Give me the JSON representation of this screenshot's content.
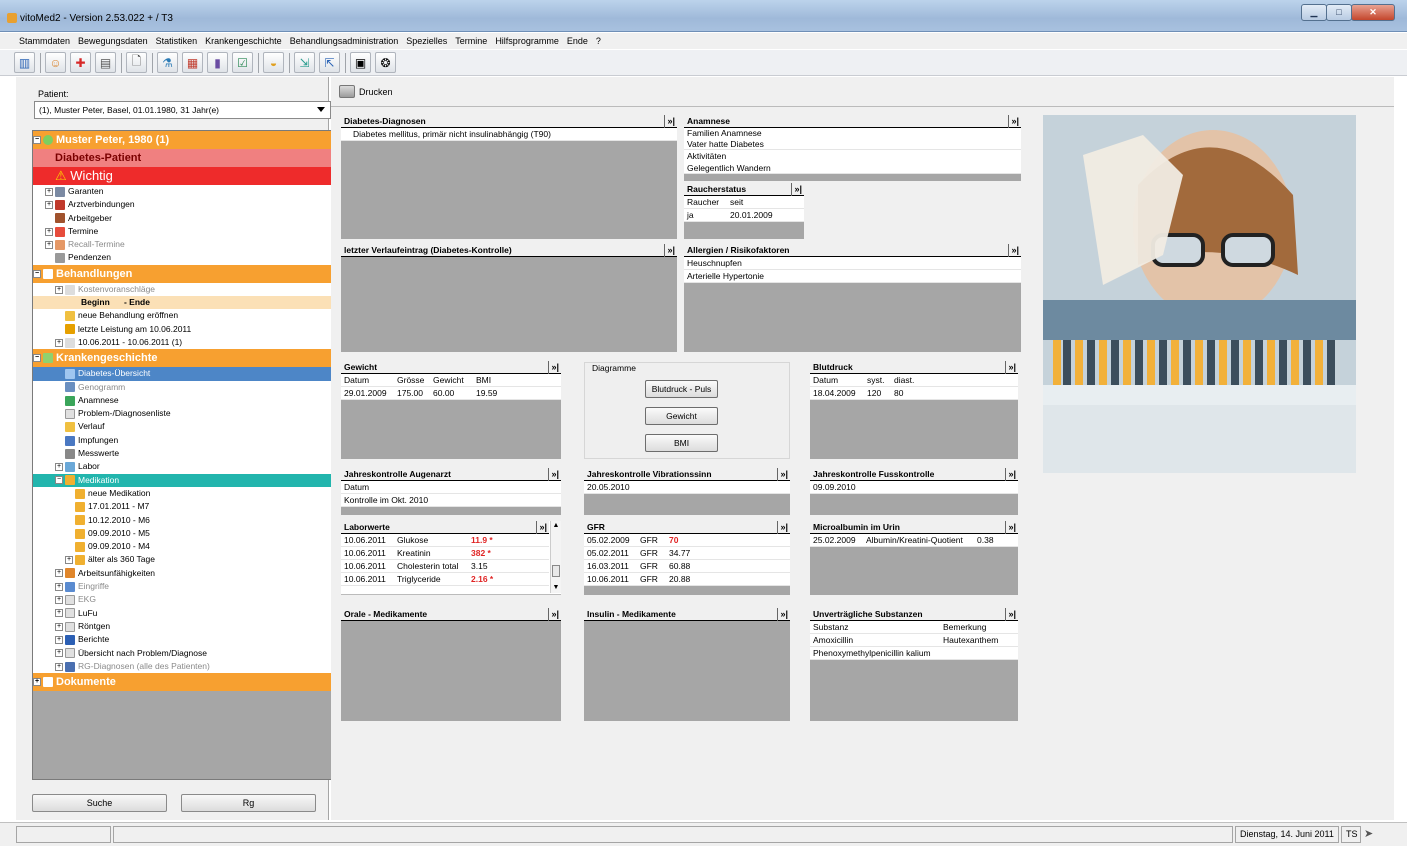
{
  "window": {
    "title": "vitoMed2 - Version 2.53.022 + / T3"
  },
  "menu": [
    "Stammdaten",
    "Bewegungsdaten",
    "Statistiken",
    "Krankengeschichte",
    "Behandlungsadministration",
    "Spezielles",
    "Termine",
    "Hilfsprogramme",
    "Ende",
    "?"
  ],
  "patient": {
    "label": "Patient:",
    "value": "(1), Muster Peter, Basel, 01.01.1980, 31 Jahr(e)"
  },
  "tree": {
    "patient_header": "Muster Peter, 1980 (1)",
    "diabetes": "Diabetes-Patient",
    "wichtig": "Wichtig",
    "items1": [
      "Garanten",
      "Arztverbindungen",
      "Arbeitgeber",
      "Termine",
      "Recall-Termine",
      "Pendenzen"
    ],
    "behandlungen": "Behandlungen",
    "kostenvoranschlaege": "Kostenvoranschläge",
    "beginn": "Beginn",
    "ende": "- Ende",
    "neue_behandlung": "neue Behandlung eröffnen",
    "letzte_leistung": "letzte Leistung am 10.06.2011",
    "period": "10.06.2011 - 10.06.2011  (1)",
    "krankengeschichte": "Krankengeschichte",
    "kg_items": [
      "Diabetes-Übersicht",
      "Genogramm",
      "Anamnese",
      "Problem-/Diagnosenliste",
      "Verlauf",
      "Impfungen",
      "Messwerte",
      "Labor"
    ],
    "medikation": "Medikation",
    "med_items": [
      "neue Medikation",
      "17.01.2011 - M7",
      "10.12.2010 - M6",
      "09.09.2010 - M5",
      "09.09.2010 - M4",
      "älter als 360 Tage"
    ],
    "items2": [
      "Arbeitsunfähigkeiten",
      "Eingriffe",
      "EKG",
      "LuFu",
      "Röntgen",
      "Berichte",
      "Übersicht nach Problem/Diagnose",
      "RG-Diagnosen (alle des Patienten)"
    ],
    "dokumente": "Dokumente"
  },
  "buttons": {
    "suche": "Suche",
    "rg": "Rg",
    "drucken": "Drucken"
  },
  "widgets": {
    "more": "»|",
    "diabetes_diagnosen": {
      "title": "Diabetes-Diagnosen",
      "line": "Diabetes mellitus, primär nicht insulinabhängig (T90)"
    },
    "anamnese": {
      "title": "Anamnese",
      "lines": [
        "Familien Anamnese",
        "Vater hatte Diabetes",
        "Aktivitäten",
        "Gelegentlich Wandern"
      ]
    },
    "raucherstatus": {
      "title": "Raucherstatus",
      "headers": [
        "Raucher",
        "seit"
      ],
      "row": [
        "ja",
        "20.01.2009"
      ]
    },
    "verlauf": {
      "title": "letzter Verlaufeintrag (Diabetes-Kontrolle)"
    },
    "allergien": {
      "title": "Allergien / Risikofaktoren",
      "lines": [
        "Heuschnupfen",
        "Arterielle Hypertonie"
      ]
    },
    "gewicht": {
      "title": "Gewicht",
      "headers": [
        "Datum",
        "Grösse",
        "Gewicht",
        "BMI"
      ],
      "row": [
        "29.01.2009",
        "175.00",
        "60.00",
        "19.59"
      ]
    },
    "diagramme": {
      "title": "Diagramme",
      "buttons": [
        "Blutdruck - Puls",
        "Gewicht",
        "BMI"
      ]
    },
    "blutdruck": {
      "title": "Blutdruck",
      "headers": [
        "Datum",
        "syst.",
        "diast."
      ],
      "row": [
        "18.04.2009",
        "120",
        "80"
      ]
    },
    "augenarzt": {
      "title": "Jahreskontrolle Augenarzt",
      "lines": [
        "Datum",
        "Kontrolle im Okt. 2010"
      ]
    },
    "vibration": {
      "title": "Jahreskontrolle Vibrationssinn",
      "line": "20.05.2010"
    },
    "fuss": {
      "title": "Jahreskontrolle Fusskontrolle",
      "line": "09.09.2010"
    },
    "laborwerte": {
      "title": "Laborwerte",
      "rows": [
        {
          "date": "10.06.2011",
          "name": "Glukose",
          "value": "11.9 *",
          "flag": true
        },
        {
          "date": "10.06.2011",
          "name": "Kreatinin",
          "value": "382 *",
          "flag": true
        },
        {
          "date": "10.06.2011",
          "name": "Cholesterin total",
          "value": "3.15",
          "flag": false
        },
        {
          "date": "10.06.2011",
          "name": "Triglyceride",
          "value": "2.16 *",
          "flag": true
        }
      ]
    },
    "gfr": {
      "title": "GFR",
      "rows": [
        {
          "date": "05.02.2009",
          "name": "GFR",
          "value": "70",
          "flag": true
        },
        {
          "date": "05.02.2011",
          "name": "GFR",
          "value": "34.77",
          "flag": false
        },
        {
          "date": "16.03.2011",
          "name": "GFR",
          "value": "60.88",
          "flag": false
        },
        {
          "date": "10.06.2011",
          "name": "GFR",
          "value": "20.88",
          "flag": false
        }
      ]
    },
    "microalbumin": {
      "title": "Microalbumin im Urin",
      "row": [
        "25.02.2009",
        "Albumin/Kreatini-Quotient",
        "0.38"
      ]
    },
    "orale": {
      "title": "Orale - Medikamente"
    },
    "insulin": {
      "title": "Insulin - Medikamente"
    },
    "unvertraeglich": {
      "title": "Unverträgliche Substanzen",
      "headers": [
        "Substanz",
        "Bemerkung"
      ],
      "rows": [
        [
          "Amoxicillin",
          "Hautexanthem"
        ],
        [
          "Phenoxymethylpenicillin kalium",
          ""
        ]
      ]
    }
  },
  "status": {
    "date": "Dienstag, 14. Juni 2011",
    "user": "TS"
  }
}
